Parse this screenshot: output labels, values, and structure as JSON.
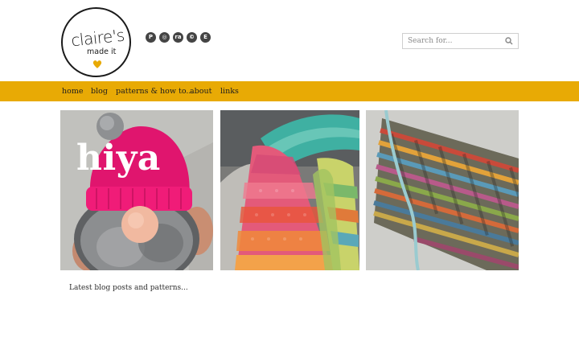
{
  "logo": {
    "main": "claire's",
    "sub": "made it",
    "heart_color": "#e8aa05"
  },
  "socials": [
    {
      "name": "pinterest-icon",
      "glyph": "P"
    },
    {
      "name": "instagram-icon",
      "glyph": "◎"
    },
    {
      "name": "ravelry-icon",
      "glyph": "ra"
    },
    {
      "name": "copyright-icon",
      "glyph": "©"
    },
    {
      "name": "etsy-icon",
      "glyph": "E"
    }
  ],
  "search": {
    "placeholder": "Search for..."
  },
  "nav": {
    "items": [
      {
        "label": "home"
      },
      {
        "label": "blog"
      },
      {
        "label": "patterns & how to..."
      },
      {
        "label": "about"
      },
      {
        "label": "links"
      }
    ],
    "background": "#e8aa05"
  },
  "featured": {
    "overlay_text": "hiya"
  },
  "latest": {
    "text": "Latest blog posts and patterns..."
  }
}
